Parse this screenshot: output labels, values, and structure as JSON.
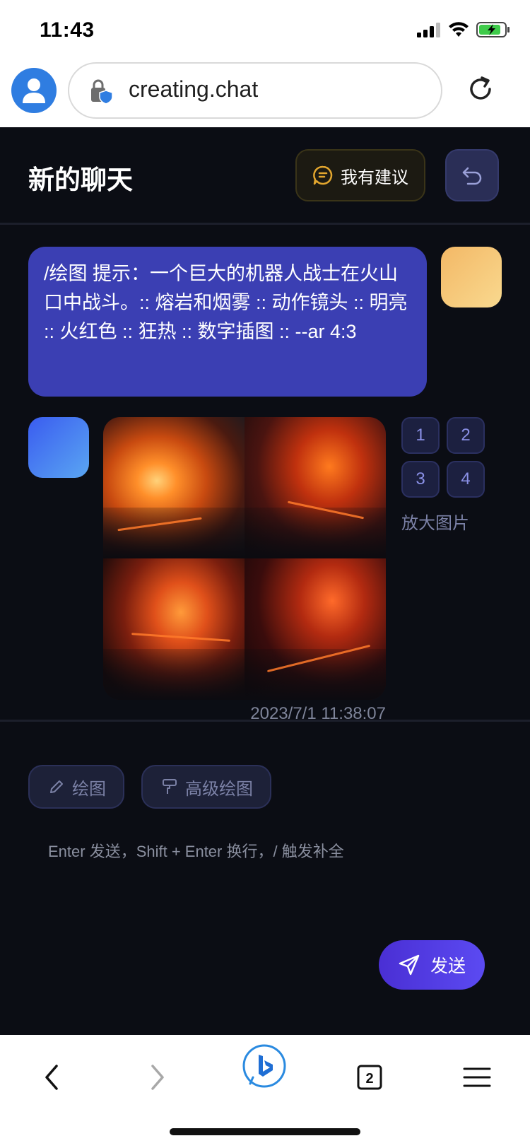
{
  "status_bar": {
    "time": "11:43"
  },
  "browser": {
    "url": "creating.chat"
  },
  "chat": {
    "title": "新的聊天",
    "suggest_label": "我有建议",
    "user_message": "/绘图 提示：一个巨大的机器人战士在火山口中战斗。:: 熔岩和烟雾 :: 动作镜头 :: 明亮 :: 火红色 :: 狂热 :: 数字插图 :: --ar 4:3",
    "image_options": [
      "1",
      "2",
      "3",
      "4"
    ],
    "zoom_label": "放大图片",
    "timestamp": "2023/7/1 11:38:07"
  },
  "input": {
    "draw_label": "绘图",
    "advanced_draw_label": "高级绘图",
    "placeholder": "Enter 发送，Shift + Enter 换行，/ 触发补全",
    "send_label": "发送"
  },
  "bottom_nav": {
    "tabs_count": "2"
  },
  "colors": {
    "bubble": "#3b3fb3",
    "background": "#0b0d14",
    "accent": "#5b4af2"
  },
  "icons": [
    "user-icon",
    "lock-icon",
    "reload-icon",
    "suggestion-icon",
    "undo-icon",
    "pencil-icon",
    "paint-roller-icon",
    "send-icon",
    "back-arrow-icon",
    "forward-arrow-icon",
    "bing-icon",
    "tabs-icon",
    "menu-icon"
  ]
}
